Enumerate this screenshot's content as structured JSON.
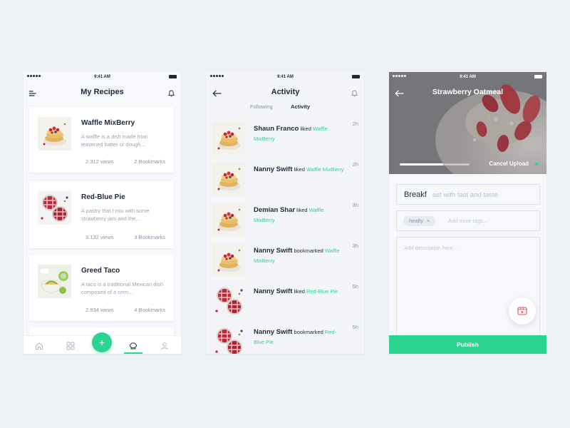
{
  "status_time": "9:41 AM",
  "my_recipes": {
    "title": "My Recipes",
    "recipes": [
      {
        "name": "Waffle MixBerry",
        "desc": "A waffle is a dish made from leavened batter or dough...",
        "views": "2.312 views",
        "bookmarks": "2 Bookmarks"
      },
      {
        "name": "Red-Blue Pie",
        "desc": "A pastry that I mix with some strawberry jam and the...",
        "views": "3.132 views",
        "bookmarks": "3 Bookmarks"
      },
      {
        "name": "Greed Taco",
        "desc": "A taco is a traditional Mexican dish composed of a corn...",
        "views": "2.934 views",
        "bookmarks": "4 Bookmarks"
      }
    ],
    "add_label": "+"
  },
  "activity": {
    "title": "Activity",
    "tabs": [
      "Following",
      "Activity"
    ],
    "active_tab": "Activity",
    "items": [
      {
        "who": "Shaun Franco",
        "action": "liked",
        "target": "Waffle MixBerry",
        "ago": "2h",
        "image": "waffle"
      },
      {
        "who": "Nanny Swift",
        "action": "liked",
        "target": "Waffle MixBerry",
        "ago": "2h",
        "image": "waffle"
      },
      {
        "who": "Demian Shar",
        "action": "liked",
        "target": "Waffle MixBerry",
        "ago": "3h",
        "image": "waffle"
      },
      {
        "who": "Nanny Swift",
        "action": "bookmarked",
        "target": "Waffle MixBerry",
        "ago": "3h",
        "image": "waffle"
      },
      {
        "who": "Nanny Swift",
        "action": "liked",
        "target": "Red-Blue Pie",
        "ago": "5h",
        "image": "pie"
      },
      {
        "who": "Nanny Swift",
        "action": "bookmarked",
        "target": "Red-Blue Pie",
        "ago": "5h",
        "image": "pie"
      }
    ]
  },
  "upload": {
    "title": "Strawberry Oatmeal",
    "progress": 0.62,
    "cancel_label": "Cancel Upload",
    "title_typed": "Breakf",
    "title_placeholder": "ast with fast and taste",
    "tag": "healty",
    "tag_remove": "×",
    "tags_placeholder": "Add more tags...",
    "description_placeholder": "Add description here...",
    "publish_label": "Publish"
  },
  "colors": {
    "accent": "#2bd591",
    "text": "#1e2a3a",
    "muted": "#9aa4b2",
    "background": "#eef1f6"
  }
}
